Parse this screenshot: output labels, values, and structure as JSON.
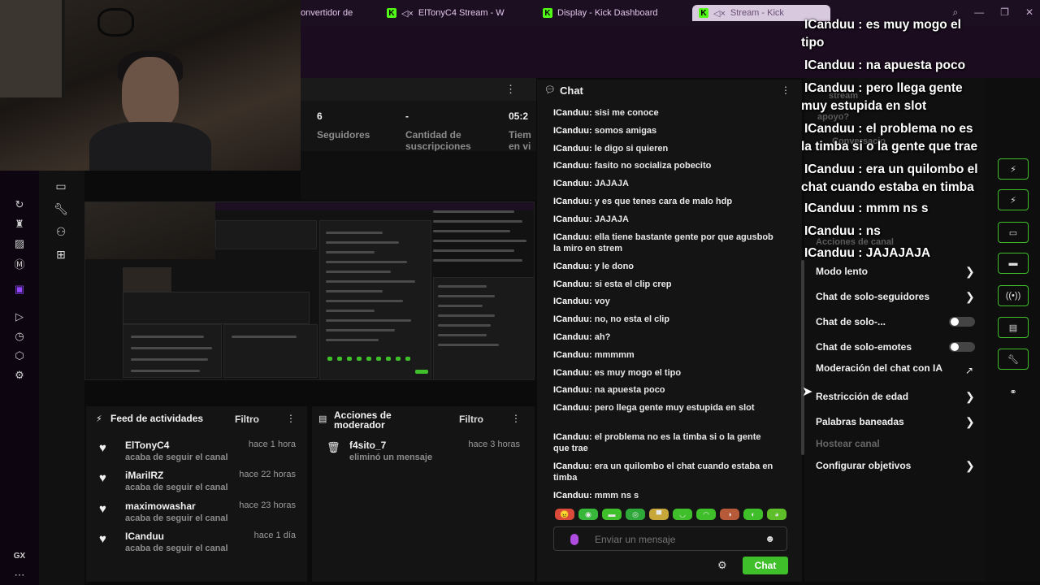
{
  "browser": {
    "tabs": [
      {
        "label": "onvertidor de",
        "kick": false,
        "active": false
      },
      {
        "label": "ElTonyC4 Stream - W",
        "kick": true,
        "active": false
      },
      {
        "label": "Display - Kick Dashboard",
        "kick": true,
        "active": false
      },
      {
        "label": "Stream - Kick",
        "kick": true,
        "active": true
      }
    ]
  },
  "stats": {
    "followers_value": "6",
    "followers_label": "Seguidores",
    "subs_value": "-",
    "subs_label_1": "Cantidad de",
    "subs_label_2": "suscripciones",
    "time_value": "05:2",
    "time_label_1": "Tiem",
    "time_label_2": "en vi"
  },
  "feed": {
    "title": "Feed de actividades",
    "filter": "Filtro",
    "items": [
      {
        "name": "ElTonyC4",
        "time": "hace 1 hora",
        "sub": "acaba de seguir el canal"
      },
      {
        "name": "iMariIRZ",
        "time": "hace 22 horas",
        "sub": "acaba de seguir el canal"
      },
      {
        "name": "maximowashar",
        "time": "hace 23 horas",
        "sub": "acaba de seguir el canal"
      },
      {
        "name": "ICanduu",
        "time": "hace 1 día",
        "sub": "acaba de seguir el canal"
      }
    ]
  },
  "mod": {
    "title_1": "Acciones de",
    "title_2": "moderador",
    "filter": "Filtro",
    "items": [
      {
        "name": "f4sito_7",
        "time": "hace 3 horas",
        "sub": "eliminó un mensaje"
      }
    ]
  },
  "chat": {
    "title": "Chat",
    "user": "ICanduu:",
    "messages": [
      "sisi me conoce",
      "somos amigas",
      "le digo si quieren",
      "fasito no socializa pobecito",
      "JAJAJA",
      "y es que tenes cara de malo hdp",
      "JAJAJA",
      "ella tiene bastante gente por que agusbob la miro en strem",
      "y le dono",
      "si esta el clip crep",
      "voy",
      "no, no esta el clip",
      "ah?",
      "mmmmm",
      "es muy mogo el tipo",
      "na apuesta poco",
      "pero llega gente muy estupida en slot",
      "el problema no es la timba si o la gente que trae",
      "era un quilombo el chat cuando estaba en timba",
      "mmm ns s"
    ],
    "input_placeholder": "Enviar un mensaje",
    "send_label": "Chat"
  },
  "channel_actions": {
    "title": "Acciones de canal",
    "items": [
      {
        "label": "Modo lento",
        "control": "arrow"
      },
      {
        "label": "Chat de solo-seguidores",
        "control": "arrow"
      },
      {
        "label": "Chat de solo-...",
        "control": "toggle"
      },
      {
        "label": "Chat de solo-emotes",
        "control": "toggle"
      },
      {
        "label": "Moderación del chat con IA",
        "control": "external"
      },
      {
        "label": "Restricción de edad",
        "control": "arrow"
      },
      {
        "label": "Palabras baneadas",
        "control": "arrow"
      },
      {
        "label": "Hostear canal",
        "control": "disabled"
      },
      {
        "label": "Configurar objetivos",
        "control": "arrow"
      }
    ]
  },
  "overlay": {
    "lines": [
      "ICanduu : es muy mogo el",
      "tipo",
      "ICanduu : na apuesta poco",
      "ICanduu : pero llega gente",
      "muy estupida en slot",
      "ICanduu : el problema no es",
      "la timba si o la gente que trae",
      "ICanduu : era un quilombo el",
      "chat cuando estaba en timba",
      "ICanduu : mmm ns s",
      "ICanduu : ns",
      "ICanduu : JAJAJAJA"
    ]
  },
  "sidebar": {
    "gx_label": "GX"
  },
  "colors": {
    "accent": "#53fc18",
    "button": "#3fbf2a",
    "twitch": "#9146ff"
  }
}
